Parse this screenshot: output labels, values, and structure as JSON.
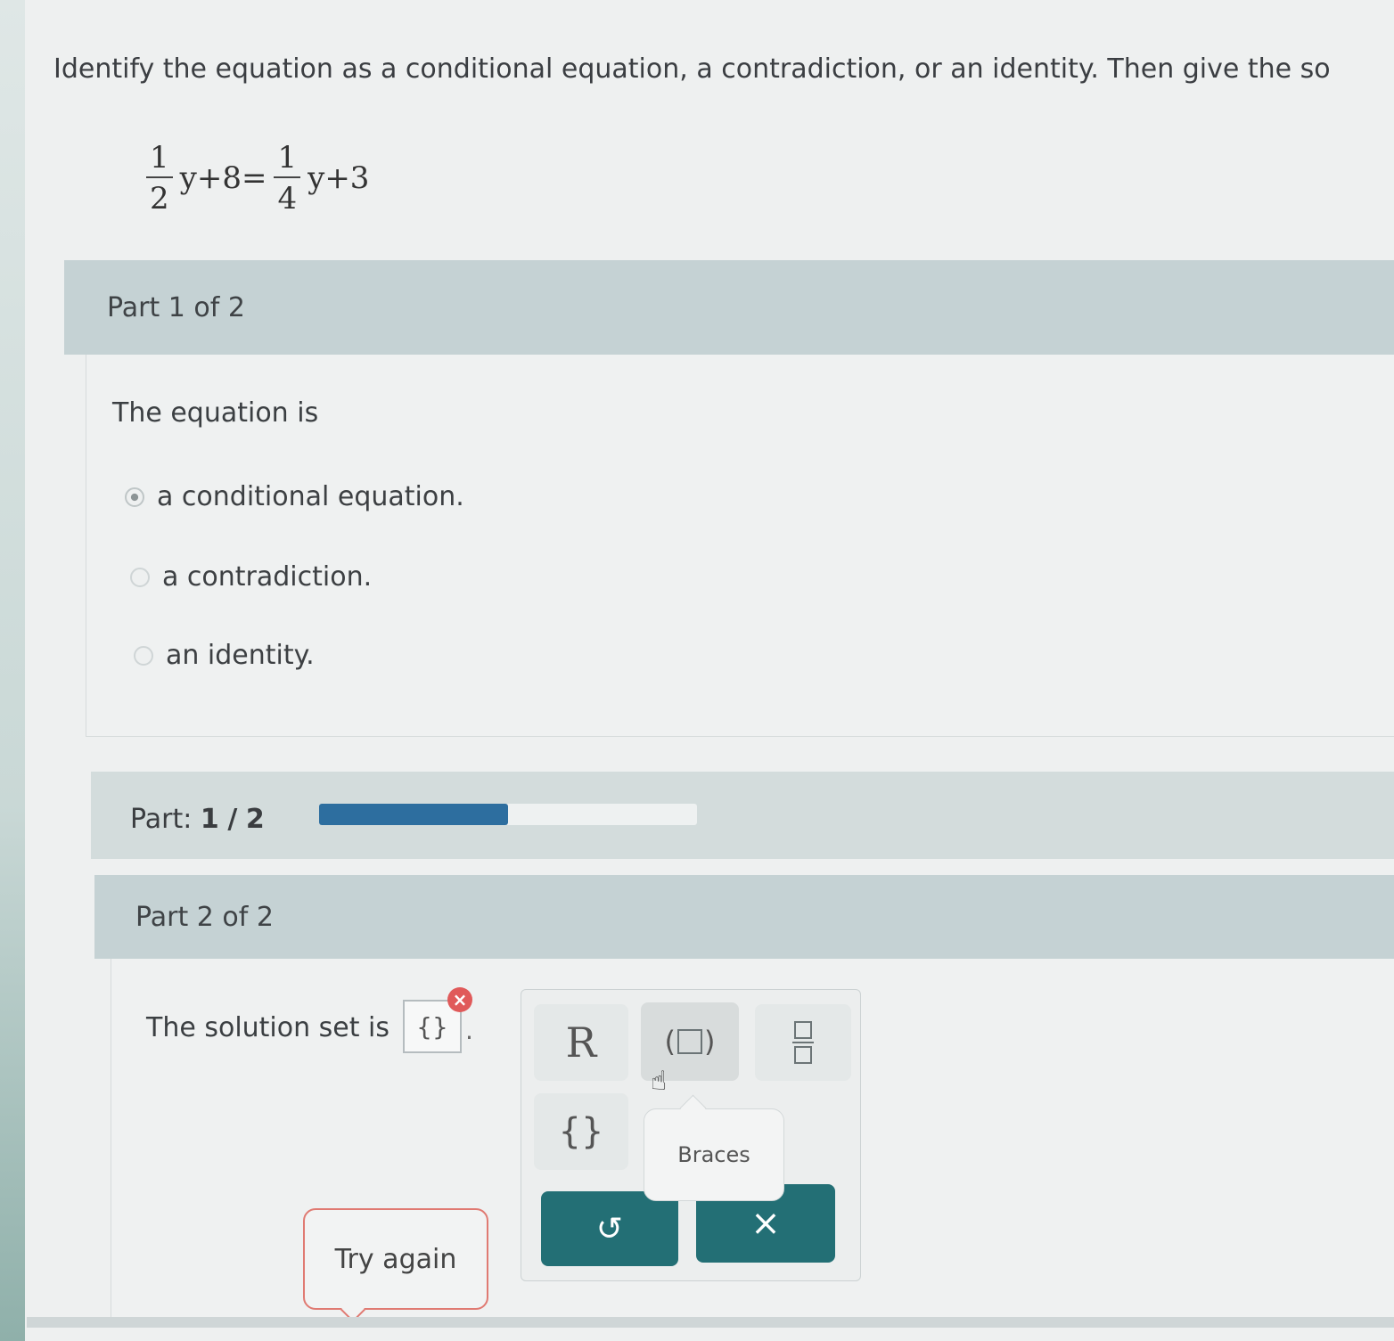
{
  "prompt": "Identify the equation as a conditional equation, a contradiction, or an identity. Then give the so",
  "equation": {
    "lhs_num": "1",
    "lhs_den": "2",
    "lhs_rest": "y+8=",
    "rhs_num": "1",
    "rhs_den": "4",
    "rhs_rest": "y+3"
  },
  "part1": {
    "header": "Part 1 of 2",
    "lead": "The equation is",
    "options": [
      "a conditional equation.",
      "a contradiction.",
      "an identity."
    ],
    "selected_index": 0
  },
  "progress": {
    "label": "Part:",
    "current": "1",
    "sep": "/",
    "total": "2",
    "fraction": 0.5
  },
  "part2": {
    "header": "Part 2 of 2",
    "lead": "The solution set is",
    "answer_value": "{}",
    "period": "."
  },
  "keypad": {
    "k1": "R",
    "k4": "{}",
    "undo": "↺",
    "clear": "×"
  },
  "tooltip": "Braces",
  "try_again": "Try again",
  "colors": {
    "accent": "#236f75",
    "progress_fill": "#2d6e9f",
    "error": "#e05a5a",
    "try_border": "#e07a72"
  }
}
